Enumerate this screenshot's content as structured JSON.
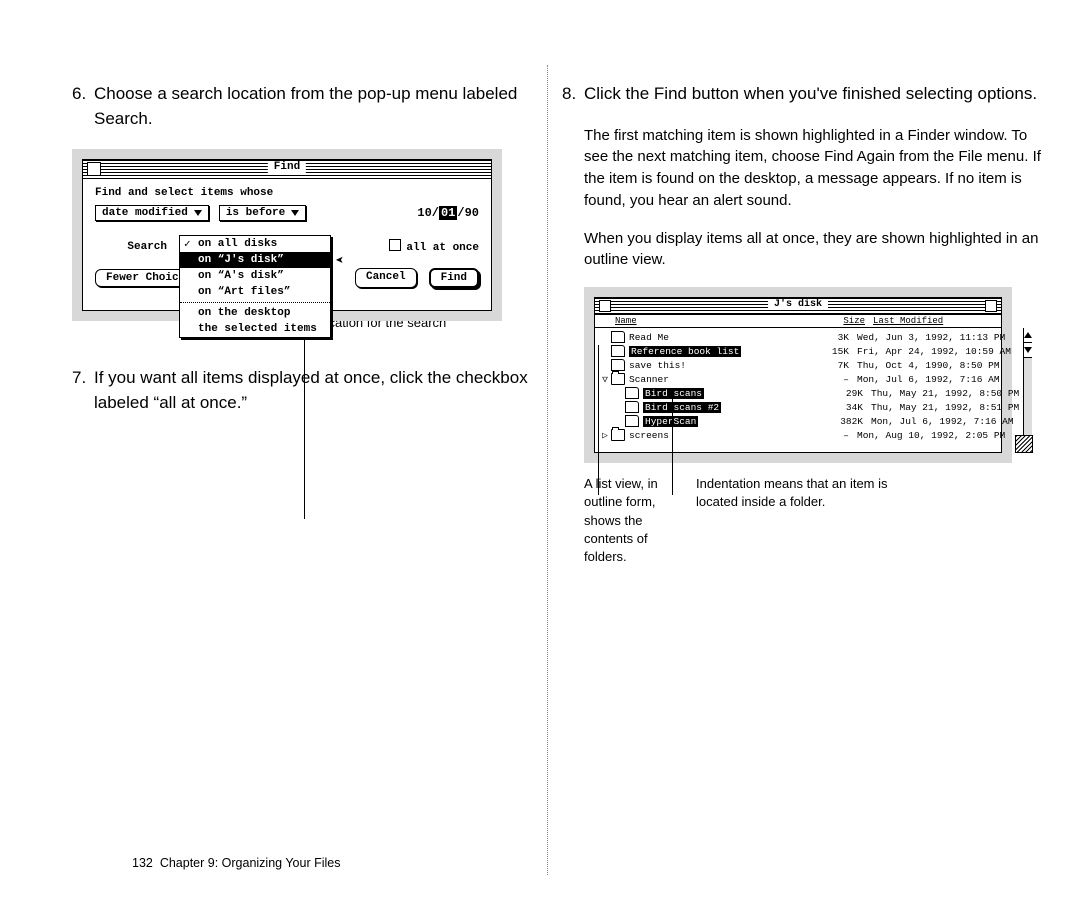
{
  "steps": {
    "s6": {
      "num": "6.",
      "text": "Choose a search location from the pop-up menu labeled Search."
    },
    "s7": {
      "num": "7.",
      "text": "If you want all items displayed at once, click the checkbox labeled “all at once.”"
    },
    "s8": {
      "num": "8.",
      "text": "Click the Find button when you've finished selecting options."
    }
  },
  "paras": {
    "p1": "The first matching item is shown highlighted in a Finder window. To see the next matching item, choose Find Again from the File menu. If the item is found on the desktop, a message appears. If no item is found, you hear an alert sound.",
    "p2": "When you display items all at once, they are shown highlighted in an outline view."
  },
  "find": {
    "title": "Find",
    "prompt": "Find and select items whose",
    "attr": "date modified",
    "op": "is before",
    "date_pre": "10/",
    "date_hl": "01",
    "date_post": "/90",
    "search_label": "Search",
    "allatonce": "all at once",
    "fewer": "Fewer Choices",
    "cancel": "Cancel",
    "findbtn": "Find",
    "menu": {
      "m0": "on all disks",
      "m1": "on “J's disk”",
      "m2": "on “A's disk”",
      "m3": "on “Art files”",
      "m4": "on the desktop",
      "m5": "the selected items"
    }
  },
  "caption1": "Location for the search",
  "list": {
    "title": "J's disk",
    "hdr_name": "Name",
    "hdr_size": "Size",
    "hdr_date": "Last Modified",
    "rows": [
      {
        "tw": "",
        "indent": 0,
        "kind": "doc",
        "name": "Read Me",
        "hl": false,
        "size": "3K",
        "date": "Wed, Jun 3, 1992, 11:13 PM"
      },
      {
        "tw": "",
        "indent": 0,
        "kind": "doc",
        "name": "Reference book list",
        "hl": true,
        "size": "15K",
        "date": "Fri, Apr 24, 1992, 10:59 AM"
      },
      {
        "tw": "",
        "indent": 0,
        "kind": "doc",
        "name": "save this!",
        "hl": false,
        "size": "7K",
        "date": "Thu, Oct 4, 1990, 8:50 PM"
      },
      {
        "tw": "▽",
        "indent": 0,
        "kind": "fold",
        "name": "Scanner",
        "hl": false,
        "size": "–",
        "date": "Mon, Jul 6, 1992, 7:16 AM"
      },
      {
        "tw": "",
        "indent": 1,
        "kind": "doc",
        "name": "Bird scans",
        "hl": true,
        "size": "29K",
        "date": "Thu, May 21, 1992, 8:50 PM"
      },
      {
        "tw": "",
        "indent": 1,
        "kind": "doc",
        "name": "Bird scans #2",
        "hl": true,
        "size": "34K",
        "date": "Thu, May 21, 1992, 8:51 PM"
      },
      {
        "tw": "",
        "indent": 1,
        "kind": "doc",
        "name": "HyperScan",
        "hl": true,
        "size": "382K",
        "date": "Mon, Jul 6, 1992, 7:16 AM"
      },
      {
        "tw": "▷",
        "indent": 0,
        "kind": "fold",
        "name": "screens",
        "hl": false,
        "size": "–",
        "date": "Mon, Aug 10, 1992, 2:05 PM"
      }
    ]
  },
  "caption2a": "A list view, in outline form, shows the contents of folders.",
  "caption2b": "Indentation means that an item is located inside a folder.",
  "footer": {
    "page": "132",
    "chapter": "Chapter 9: Organizing Your Files"
  }
}
